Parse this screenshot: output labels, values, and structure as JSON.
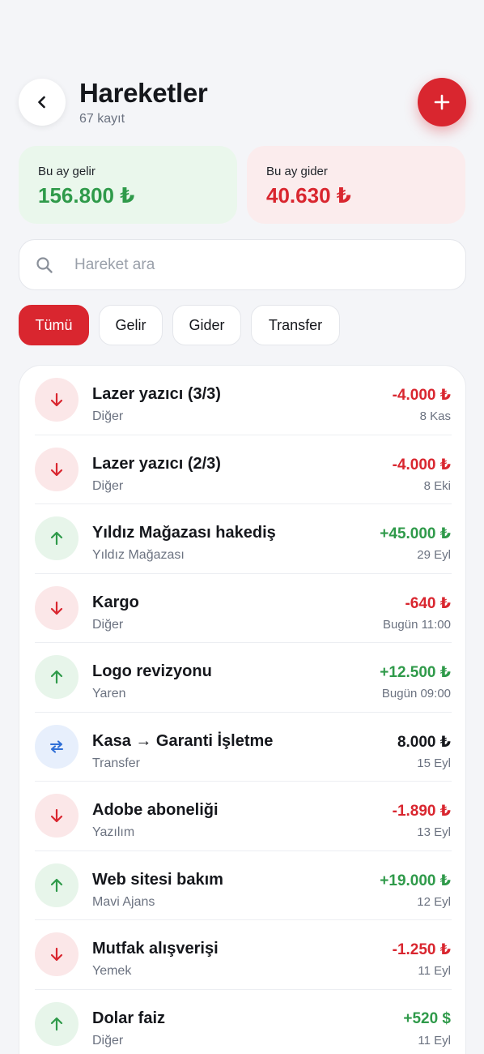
{
  "header": {
    "title": "Hareketler",
    "subtitle": "67 kayıt",
    "back_icon": "chevron-left-icon",
    "add_icon": "plus-icon"
  },
  "summary": {
    "income_label": "Bu ay gelir",
    "income_value": "156.800 ₺",
    "expense_label": "Bu ay gider",
    "expense_value": "40.630 ₺"
  },
  "search": {
    "placeholder": "Hareket ara",
    "value": ""
  },
  "filters": [
    "Tümü",
    "Gelir",
    "Gider",
    "Transfer"
  ],
  "active_filter": "Tümü",
  "colors": {
    "accent": "#d9262f",
    "income": "#2f9a4a",
    "expense": "#d9262f",
    "transfer": "#2f6fd6"
  },
  "transactions": [
    {
      "title": "Lazer yazıcı (3/3)",
      "category": "Diğer",
      "amount": "-4.000 ₺",
      "date": "8 Kas",
      "type": "down"
    },
    {
      "title": "Lazer yazıcı (2/3)",
      "category": "Diğer",
      "amount": "-4.000 ₺",
      "date": "8 Eki",
      "type": "down"
    },
    {
      "title": "Yıldız Mağazası hakediş",
      "category": "Yıldız Mağazası",
      "amount": "+45.000 ₺",
      "date": "29 Eyl",
      "type": "up"
    },
    {
      "title": "Kargo",
      "category": "Diğer",
      "amount": "-640 ₺",
      "date": "Bugün 11:00",
      "type": "down"
    },
    {
      "title": "Logo revizyonu",
      "category": "Yaren",
      "amount": "+12.500 ₺",
      "date": "Bugün 09:00",
      "type": "up"
    },
    {
      "title": "Kasa → Garanti İşletme",
      "category": "Transfer",
      "amount": "8.000 ₺",
      "date": "15 Eyl",
      "type": "transfer"
    },
    {
      "title": "Adobe aboneliği",
      "category": "Yazılım",
      "amount": "-1.890 ₺",
      "date": "13 Eyl",
      "type": "down"
    },
    {
      "title": "Web sitesi bakım",
      "category": "Mavi Ajans",
      "amount": "+19.000 ₺",
      "date": "12 Eyl",
      "type": "up"
    },
    {
      "title": "Mutfak alışverişi",
      "category": "Yemek",
      "amount": "-1.250 ₺",
      "date": "11 Eyl",
      "type": "down"
    },
    {
      "title": "Dolar faiz",
      "category": "Diğer",
      "amount": "+520 $",
      "date": "11 Eyl",
      "type": "up"
    }
  ]
}
